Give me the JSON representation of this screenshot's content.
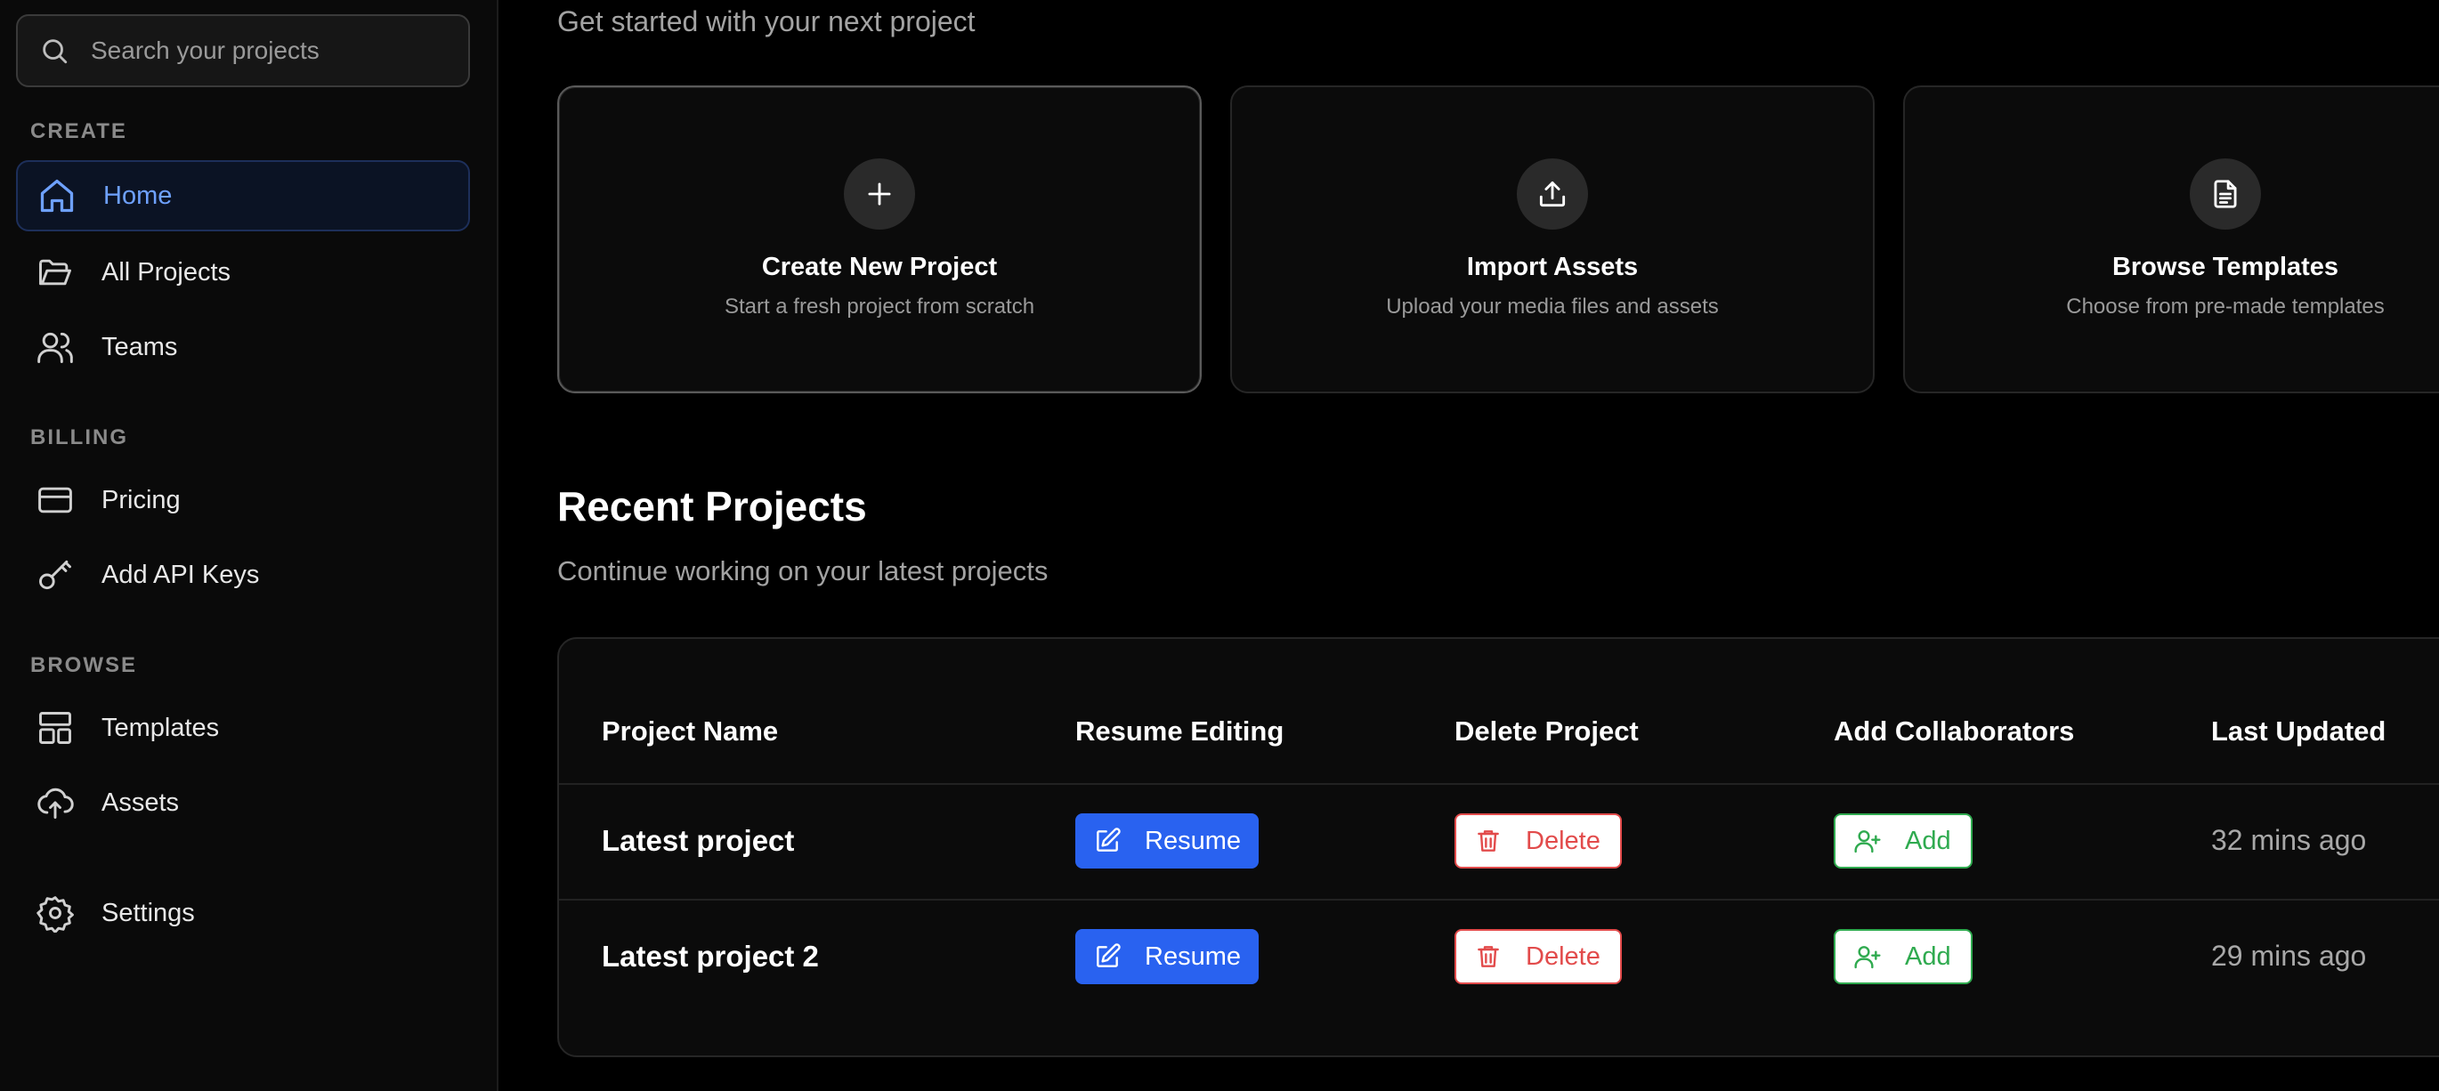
{
  "sidebar": {
    "search": {
      "placeholder": "Search your projects"
    },
    "sections": [
      {
        "title": "CREATE",
        "items": [
          {
            "label": "Home",
            "icon": "home-icon",
            "active": true
          },
          {
            "label": "All Projects",
            "icon": "folder-open-icon"
          },
          {
            "label": "Teams",
            "icon": "users-icon"
          }
        ]
      },
      {
        "title": "BILLING",
        "items": [
          {
            "label": "Pricing",
            "icon": "credit-card-icon"
          },
          {
            "label": "Add API Keys",
            "icon": "key-icon"
          }
        ]
      },
      {
        "title": "BROWSE",
        "items": [
          {
            "label": "Templates",
            "icon": "layout-icon"
          },
          {
            "label": "Assets",
            "icon": "cloud-upload-icon"
          }
        ]
      }
    ],
    "settings": {
      "label": "Settings",
      "icon": "gear-icon"
    }
  },
  "main": {
    "subtitle": "Get started with your next project",
    "cards": [
      {
        "title": "Create New Project",
        "description": "Start a fresh project from scratch",
        "icon": "plus-icon"
      },
      {
        "title": "Import Assets",
        "description": "Upload your media files and assets",
        "icon": "upload-icon"
      },
      {
        "title": "Browse Templates",
        "description": "Choose from pre-made templates",
        "icon": "document-icon"
      }
    ],
    "recent": {
      "heading": "Recent Projects",
      "subheading": "Continue working on your latest projects",
      "columns": [
        "Project Name",
        "Resume Editing",
        "Delete Project",
        "Add Collaborators",
        "Last Updated"
      ],
      "rows": [
        {
          "name": "Latest project",
          "resume": "Resume",
          "delete": "Delete",
          "add": "Add",
          "updated": "32 mins ago"
        },
        {
          "name": "Latest project 2",
          "resume": "Resume",
          "delete": "Delete",
          "add": "Add",
          "updated": "29 mins ago"
        }
      ]
    }
  },
  "colors": {
    "accent": "#2962f0",
    "active_text": "#6ea1ff",
    "danger": "#e24b4b",
    "success": "#2faa4f"
  }
}
